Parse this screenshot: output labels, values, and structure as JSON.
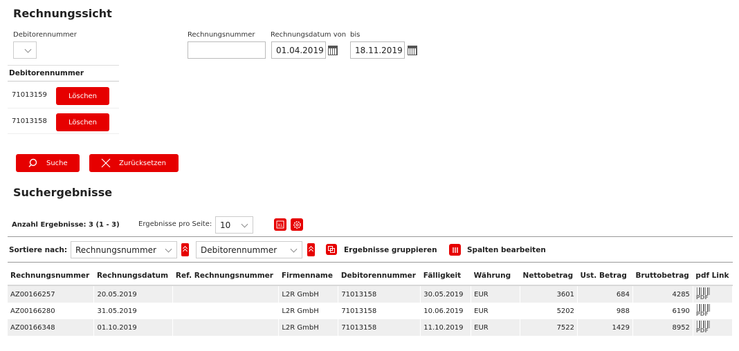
{
  "header": {
    "title": "Rechnungssicht"
  },
  "filters": {
    "debitor_label": "Debitorennummer",
    "rechnungsnummer_label": "Rechnungsnummer",
    "datum_von_label": "Rechnungsdatum von",
    "bis_label": "bis",
    "rechnungsnummer_value": "",
    "datum_von_value": "01.04.2019",
    "datum_bis_value": "18.11.2019"
  },
  "debitor_table": {
    "header": "Debitorennummer",
    "rows": [
      {
        "number": "71013159",
        "delete_label": "Löschen"
      },
      {
        "number": "71013158",
        "delete_label": "Löschen"
      }
    ]
  },
  "actions": {
    "search_label": "Suche",
    "reset_label": "Zurücksetzen"
  },
  "results": {
    "title": "Suchergebnisse",
    "count_label": "Anzahl Ergebnisse: 3 (1 - 3)",
    "per_page_label": "Ergebnisse pro Seite:",
    "per_page_value": "10",
    "sort_label": "Sortiere nach:",
    "sort1_value": "Rechnungsnummer",
    "sort2_value": "Debitorennummer",
    "group_label": "Ergebnisse gruppieren",
    "columns_label": "Spalten bearbeiten"
  },
  "table": {
    "columns": [
      "Rechnungsnummer",
      "Rechnungsdatum",
      "Ref. Rechnungsnummer",
      "Firmenname",
      "Debitorennummer",
      "Fälligkeit",
      "Währung",
      "Nettobetrag",
      "Ust. Betrag",
      "Bruttobetrag",
      "pdf Link"
    ],
    "rows": [
      [
        "AZ00166257",
        "20.05.2019",
        "",
        "L2R GmbH",
        "71013158",
        "30.05.2019",
        "EUR",
        "3601",
        "684",
        "4285"
      ],
      [
        "AZ00166280",
        "31.05.2019",
        "",
        "L2R GmbH",
        "71013158",
        "10.06.2019",
        "EUR",
        "5202",
        "988",
        "6190"
      ],
      [
        "AZ00166348",
        "01.10.2019",
        "",
        "L2R GmbH",
        "71013158",
        "11.10.2019",
        "EUR",
        "7522",
        "1429",
        "8952"
      ]
    ],
    "pdf_text": "PDF"
  },
  "colors": {
    "accent": "#e60000",
    "row_alt": "#efefef"
  }
}
